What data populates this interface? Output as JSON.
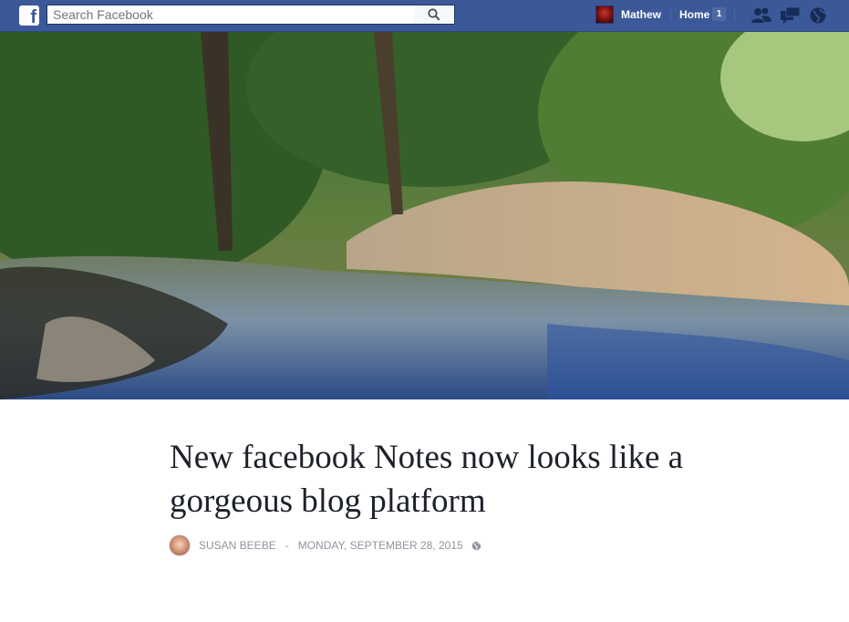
{
  "topbar": {
    "logo_letter": "f",
    "search_placeholder": "Search Facebook",
    "user_name": "Mathew",
    "home_label": "Home",
    "home_count": "1",
    "icons": [
      "search-icon",
      "friend-requests-icon",
      "messages-icon",
      "notifications-globe-icon"
    ]
  },
  "colors": {
    "brand": "#3b5998",
    "text": "#1d2129",
    "meta": "#90949c"
  },
  "article": {
    "title": "New facebook Notes now looks like a gorgeous blog platform",
    "author": "SUSAN BEEBE",
    "separator": "-",
    "date": "MONDAY, SEPTEMBER 28, 2015",
    "privacy_icon": "public-globe-icon"
  }
}
